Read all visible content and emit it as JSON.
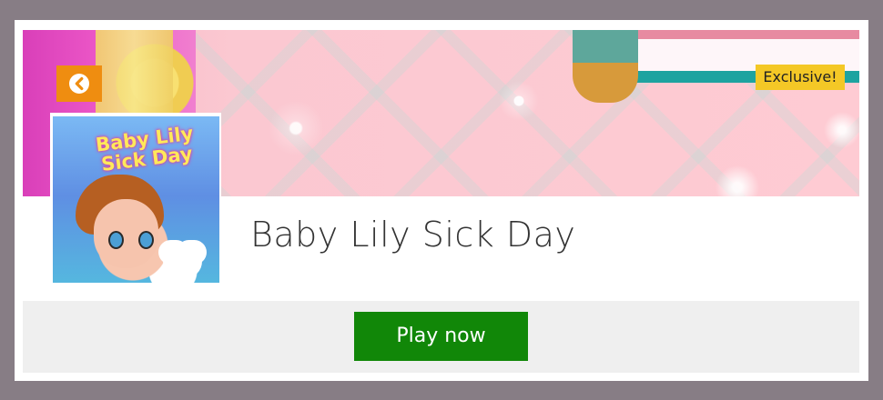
{
  "game": {
    "title": "Baby Lily Sick Day",
    "badge": "Exclusive!",
    "thumbnail_title": "Baby Lily Sick Day"
  },
  "actions": {
    "back_icon": "chevron-left-icon",
    "play_label": "Play now"
  },
  "colors": {
    "page_background": "#877d85",
    "back_button": "#ef8d10",
    "badge": "#f4c826",
    "play_button": "#118708",
    "footer": "#efefef"
  }
}
